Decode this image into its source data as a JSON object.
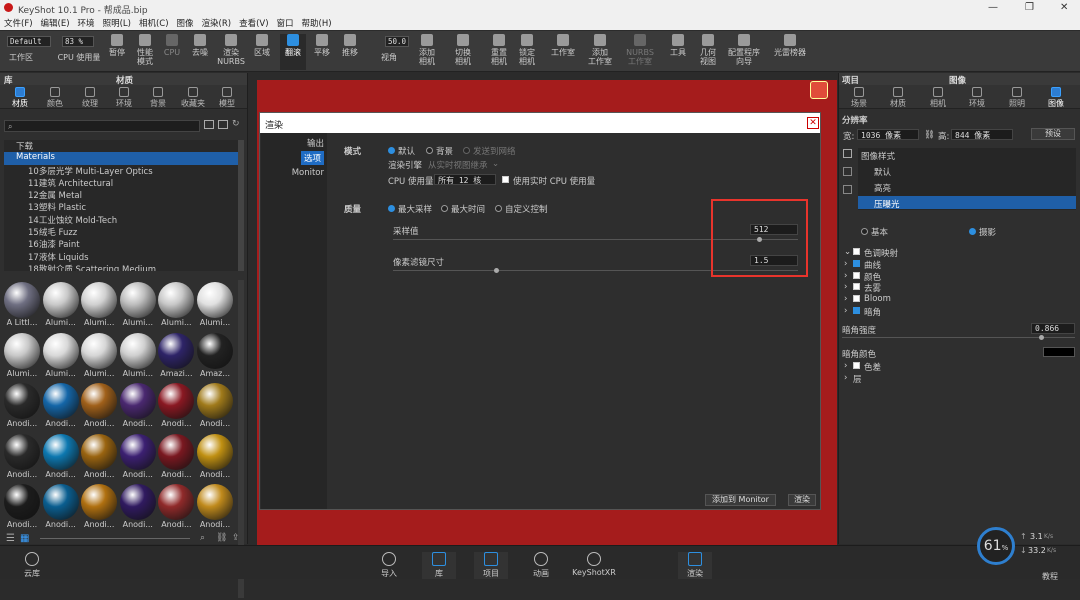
{
  "window": {
    "title": "KeyShot 10.1 Pro - 帮成品.bip",
    "controls": [
      "—",
      "❐",
      "✕"
    ]
  },
  "menu": [
    "文件(F)",
    "编辑(E)",
    "环境",
    "照明(L)",
    "相机(C)",
    "图像",
    "渲染(R)",
    "查看(V)",
    "窗口",
    "帮助(H)"
  ],
  "toolbar": {
    "preset": "Default",
    "cpu_pct": "83 %",
    "res_value": "50.0",
    "items": [
      "工作区",
      "CPU 使用量",
      "暂停",
      "性能\n模式",
      "CPU",
      "去噪",
      "渲染\nNURBS",
      "区域",
      "翻滚",
      "平移",
      "推移",
      "视角",
      "添加\n相机",
      "切换\n相机",
      "重置\n相机",
      "锁定\n相机",
      "工作室",
      "添加\n工作室",
      "NURBS\n工作室",
      "工具",
      "几何\n视图",
      "配置程序\n向导",
      "光雷榜器"
    ],
    "active": "翻滚"
  },
  "left_panel": {
    "lib_title": "库",
    "mat_title": "材质",
    "tabs": [
      "材质",
      "颜色",
      "纹理",
      "环境",
      "背景",
      "收藏夹",
      "模型"
    ],
    "tree": [
      "下载",
      "Materials",
      "10多层光学 Multi-Layer Optics",
      "11建筑 Architectural",
      "12金属 Metal",
      "13塑料 Plastic",
      "14工业蚀纹 Mold-Tech",
      "15绒毛 Fuzz",
      "16油漆 Paint",
      "17液体 Liquids",
      "18散射介质 Scattering Medium"
    ],
    "thumbs": [
      "A Littl...",
      "Alumi...",
      "Alumi...",
      "Alumi...",
      "Alumi...",
      "Alumi...",
      "Alumi...",
      "Alumi...",
      "Alumi...",
      "Alumi...",
      "Amazi...",
      "Amaz...",
      "Anodi...",
      "Anodi...",
      "Anodi...",
      "Anodi...",
      "Anodi...",
      "Anodi...",
      "Anodi...",
      "Anodi...",
      "Anodi...",
      "Anodi...",
      "Anodi...",
      "Anodi...",
      "Anodi...",
      "Anodi...",
      "Anodi...",
      "Anodi...",
      "Anodi...",
      "Anodi..."
    ],
    "colors": [
      "#6f6f82",
      "#c9c9c9",
      "#d0d0d0",
      "#bdbdbd",
      "#c8c8c8",
      "#e0e0e0",
      "#c8c8c8",
      "#d8d8d8",
      "#d6d6d6",
      "#cfcfcf",
      "#2e2468",
      "#222222",
      "#2a2a2a",
      "#1466a8",
      "#a0601a",
      "#4a2870",
      "#8a1822",
      "#a07a1a",
      "#2a2a2a",
      "#0d78b0",
      "#9a6410",
      "#3c2072",
      "#7a1820",
      "#c09012",
      "#1c1c1c",
      "#0a5e90",
      "#b07010",
      "#301a60",
      "#902a2a",
      "#c08a1c"
    ]
  },
  "dialog": {
    "title": "渲染",
    "close": "✕",
    "side": [
      "输出",
      "选项",
      "Monitor"
    ],
    "side_selected": "选项",
    "mode_label": "模式",
    "mode_opts": [
      "默认",
      "背景",
      "发送到网络"
    ],
    "engine_label": "渲染引擎",
    "engine_value": "从实时视图继承",
    "cpu_label": "CPU 使用量",
    "cpu_value": "所有 12 核",
    "realtime_cpu": "使用实时 CPU 使用量",
    "quality_label": "质量",
    "quality_opts": [
      "最大采样",
      "最大时间",
      "自定义控制"
    ],
    "samples_label": "采样值",
    "samples_value": "512",
    "pixel_filter_label": "像素滤镜尺寸",
    "pixel_filter_value": "1.5",
    "add_monitor": "添加到 Monitor",
    "render_btn": "渲染"
  },
  "right_panel": {
    "project_title": "项目",
    "image_title": "图像",
    "tabs": [
      "场景",
      "材质",
      "相机",
      "环境",
      "照明",
      "图像"
    ],
    "resolution_label": "分辨率",
    "width_label": "宽:",
    "width_value": "1036 像素",
    "height_label": "高:",
    "height_value": "844 像素",
    "preset_label": "预设",
    "styles_header": "图像样式",
    "styles": [
      "默认",
      "高亮",
      "压曝光"
    ],
    "style_selected": "压曝光",
    "mode_basic": "基本",
    "mode_photo": "摄影",
    "effects": [
      {
        "label": "色调映射",
        "checked": false,
        "expanded": true
      },
      {
        "label": "曲线",
        "checked": true
      },
      {
        "label": "颜色",
        "checked": false
      },
      {
        "label": "去雾",
        "checked": false
      },
      {
        "label": "Bloom",
        "checked": false
      },
      {
        "label": "暗角",
        "checked": true
      }
    ],
    "vignette_strength_label": "暗角强度",
    "vignette_strength_value": "0.866",
    "vignette_color_label": "暗角颜色",
    "vignette_color": "#000000",
    "more": [
      "色差",
      "层"
    ]
  },
  "status": {
    "items": [
      "云库",
      "导入",
      "库",
      "项目",
      "动画",
      "KeyShotXR",
      "渲染"
    ],
    "active": [
      "库",
      "项目",
      "渲染"
    ],
    "cpu_gauge": "61",
    "upload": "3.1",
    "download": "33.2",
    "speed_unit": "K/s",
    "help": "教程"
  }
}
